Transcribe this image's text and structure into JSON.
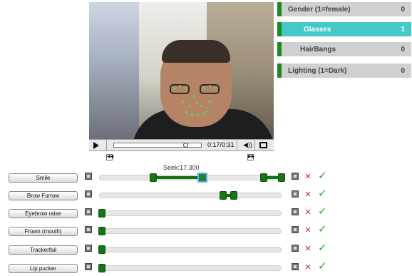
{
  "video": {
    "time": "0:17/0:31"
  },
  "seek": {
    "label": "Seek:17.300"
  },
  "attributes": [
    {
      "label": "Gender (1=female)",
      "value": "0",
      "selected": false
    },
    {
      "label": "Glasses",
      "value": "1",
      "selected": true
    },
    {
      "label": "HairBangs",
      "value": "0",
      "selected": false
    },
    {
      "label": "Lighting (1=Dark)",
      "value": "0",
      "selected": false
    }
  ],
  "actions": [
    {
      "label": "Smile"
    },
    {
      "label": "Brow Furrow"
    },
    {
      "label": "Eyebrow raise"
    },
    {
      "label": "Frown (mouth)"
    },
    {
      "label": "Trackerfail"
    },
    {
      "label": "Lip pucker"
    }
  ],
  "colors": {
    "accent_green": "#1f8a1f",
    "selected_teal": "#45c8c8",
    "delete_red": "#d02020",
    "check_green": "#2ea52e"
  },
  "icons": {
    "play": "play-icon",
    "volume": "volume-icon",
    "fullscreen": "fullscreen-icon",
    "prev": "rewind-icon",
    "next": "forward-icon",
    "delete": "close-icon",
    "confirm": "check-icon"
  }
}
